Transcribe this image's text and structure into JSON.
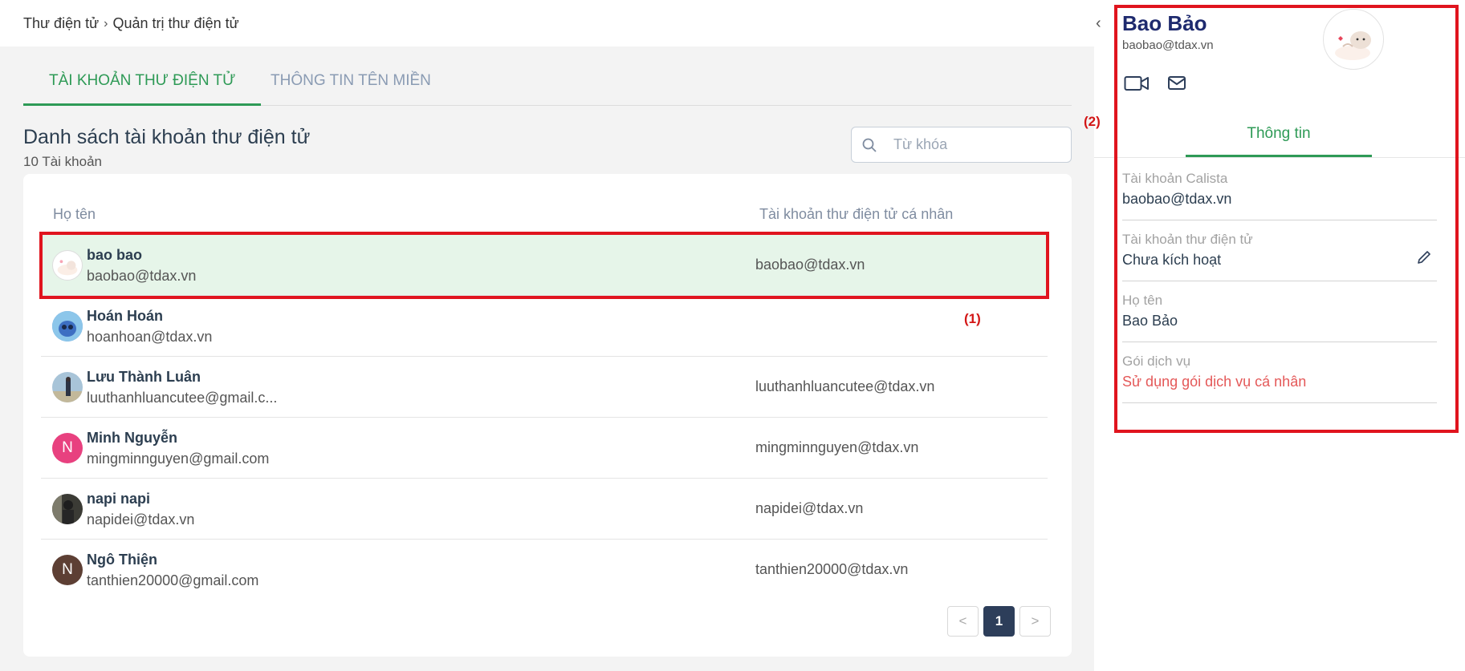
{
  "breadcrumb": {
    "items": [
      "Thư điện tử",
      "Quản trị thư điện tử"
    ]
  },
  "tabs": [
    {
      "label": "TÀI KHOẢN THƯ ĐIỆN TỬ",
      "active": true
    },
    {
      "label": "THÔNG TIN TÊN MIỀN",
      "active": false
    }
  ],
  "list": {
    "title": "Danh sách tài khoản thư điện tử",
    "count": "10 Tài khoản",
    "search_placeholder": "Từ khóa",
    "columns": {
      "name": "Họ tên",
      "personal": "Tài khoản thư điện tử cá nhân"
    },
    "rows": [
      {
        "name": "bao bao",
        "email": "baobao@tdax.vn",
        "personal": "baobao@tdax.vn",
        "avatar": "cat-avatar",
        "selected": true
      },
      {
        "name": "Hoán Hoán",
        "email": "hoanhoan@tdax.vn",
        "personal": "",
        "avatar": "stitch-avatar",
        "selected": false
      },
      {
        "name": "Lưu Thành Luân",
        "email": "luuthanhluancutee@gmail.c...",
        "personal": "luuthanhluancutee@tdax.vn",
        "avatar": "photo-avatar",
        "selected": false
      },
      {
        "name": "Minh Nguyễn",
        "email": "mingminnguyen@gmail.com",
        "personal": "mingminnguyen@tdax.vn",
        "avatar_letter": "N",
        "avatar_color": "#e8417f",
        "selected": false
      },
      {
        "name": "napi napi",
        "email": "napidei@tdax.vn",
        "personal": "napidei@tdax.vn",
        "avatar": "dark-photo-avatar",
        "selected": false
      },
      {
        "name": "Ngô Thiện",
        "email": "tanthien20000@gmail.com",
        "personal": "tanthien20000@tdax.vn",
        "avatar_letter": "N",
        "avatar_color": "#5d3f34",
        "selected": false
      }
    ]
  },
  "annotations": {
    "one": "(1)",
    "two": "(2)"
  },
  "pagination": {
    "prev": "<",
    "current": "1",
    "next": ">"
  },
  "detail": {
    "name": "Bao Bảo",
    "email": "baobao@tdax.vn",
    "tab": "Thông tin",
    "fields": [
      {
        "label": "Tài khoản Calista",
        "value": "baobao@tdax.vn"
      },
      {
        "label": "Tài khoản thư điện tử",
        "value": "Chưa kích hoạt"
      },
      {
        "label": "Họ tên",
        "value": "Bao Bảo"
      },
      {
        "label": "Gói dịch vụ",
        "value": "Sử dụng gói dịch vụ cá nhân"
      }
    ]
  },
  "colors": {
    "accent": "#2e9a56",
    "highlight": "#e0141e",
    "selected_row": "#e6f5e9",
    "warning_text": "#e45858",
    "pager_active": "#2d3e5a"
  }
}
